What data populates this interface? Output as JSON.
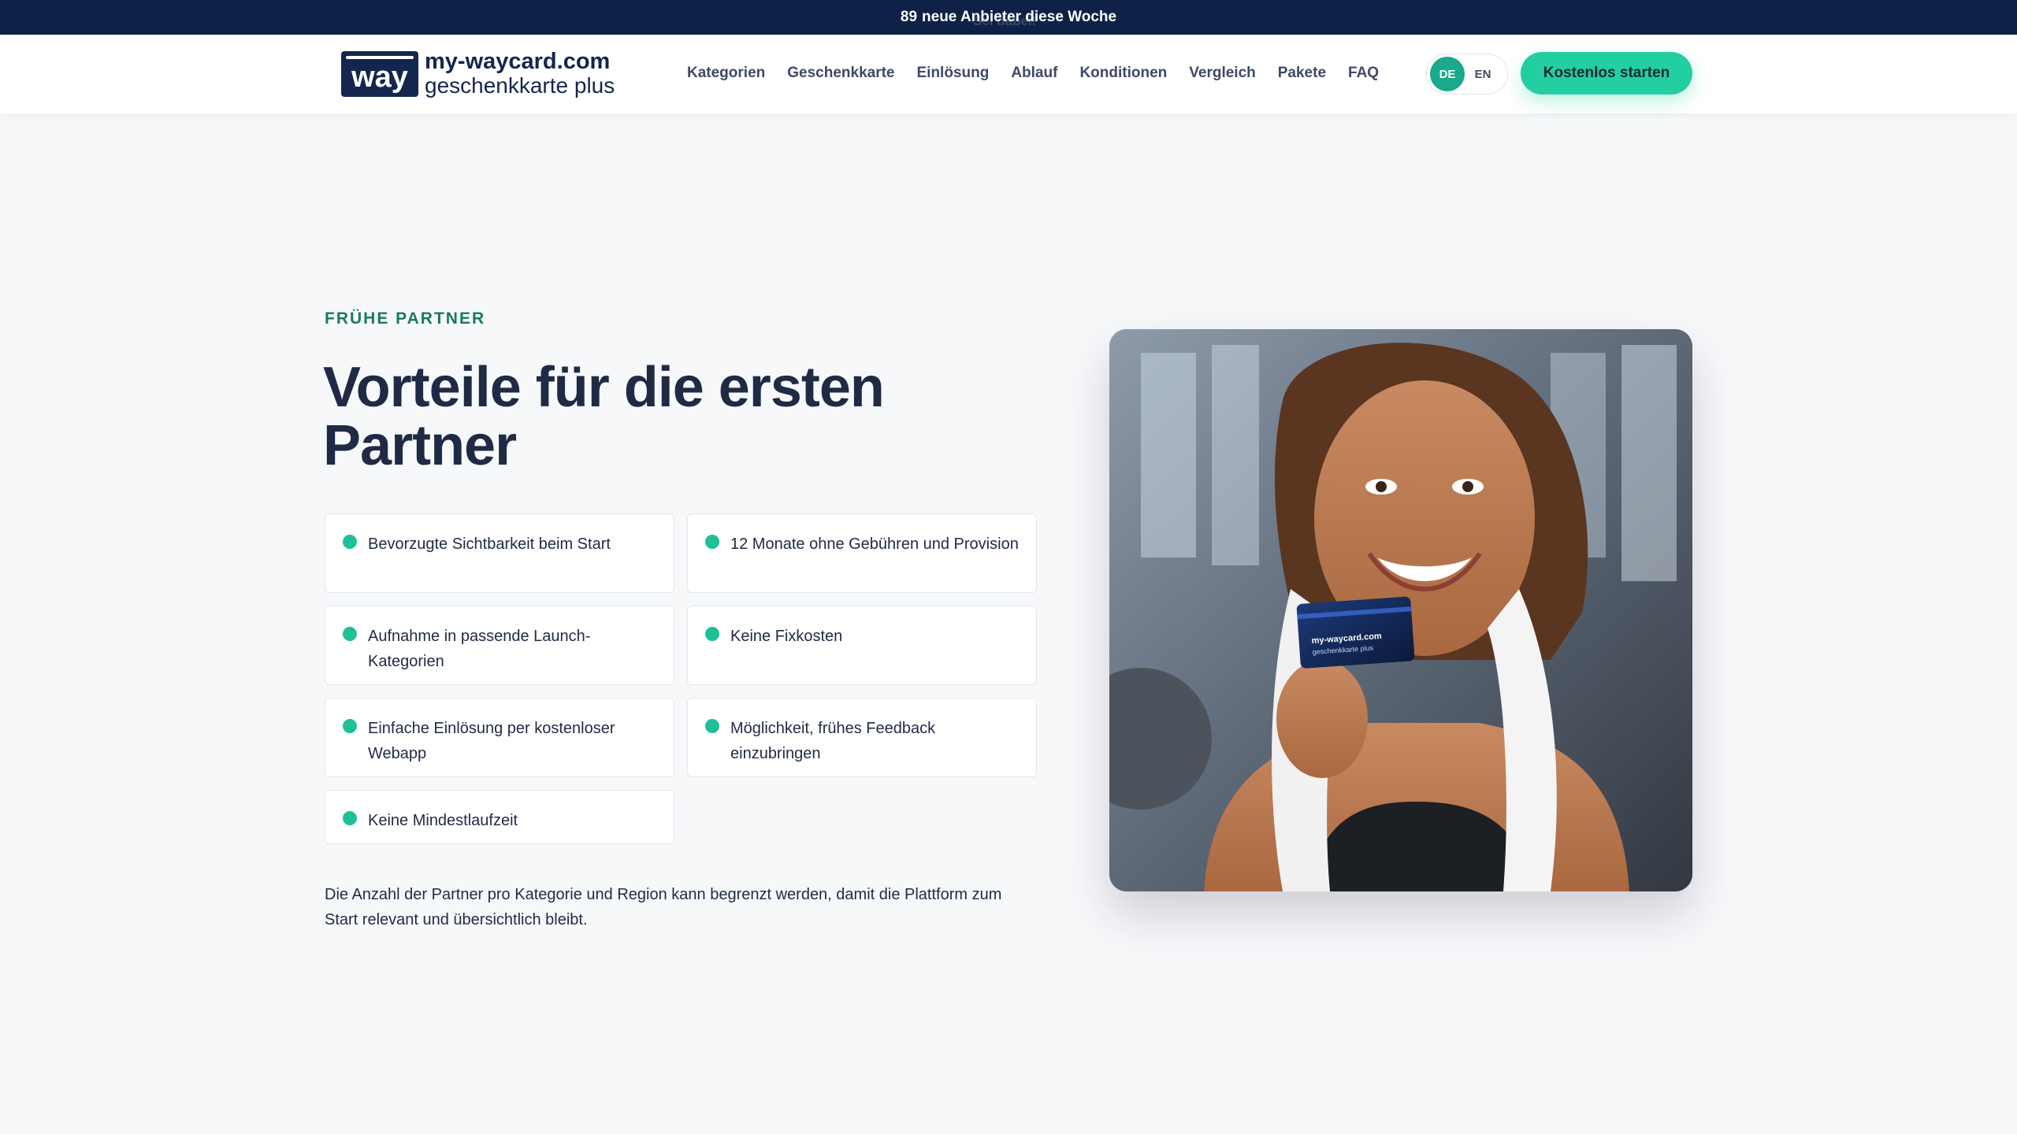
{
  "topbar": {
    "count": "89",
    "text": "neue Anbieter diese Woche",
    "ghost": "Sei dabei!"
  },
  "logo": {
    "mark": "way",
    "line1": "my-waycard.com",
    "line2": "geschenkkarte plus"
  },
  "nav": {
    "items": [
      "Kategorien",
      "Geschenkkarte",
      "Einlösung",
      "Ablauf",
      "Konditionen",
      "Vergleich",
      "Pakete",
      "FAQ"
    ]
  },
  "lang": {
    "active": "DE",
    "other": "EN"
  },
  "cta": {
    "label": "Kostenlos starten"
  },
  "hero": {
    "eyebrow": "FRÜHE PARTNER",
    "title": "Vorteile für die ersten Partner",
    "benefits": [
      "Bevorzugte Sichtbarkeit beim Start",
      "12 Monate ohne Gebühren und Provision",
      "Aufnahme in passende Launch-Kategorien",
      "Keine Fixkosten",
      "Einfache Einlösung per kostenloser Webapp",
      "Möglichkeit, frühes Feedback einzubringen",
      "Keine Mindestlaufzeit"
    ],
    "note": "Die Anzahl der Partner pro Kategorie und Region kann begrenzt werden, damit die Plattform zum Start relevant und übersichtlich bleibt."
  },
  "photo": {
    "card_text1": "my-waycard.com",
    "card_text2": "geschenkkarte plus"
  },
  "colors": {
    "brand_navy": "#14264f",
    "accent_green": "#23cfa0",
    "eyebrow_green": "#1a7a5f"
  }
}
